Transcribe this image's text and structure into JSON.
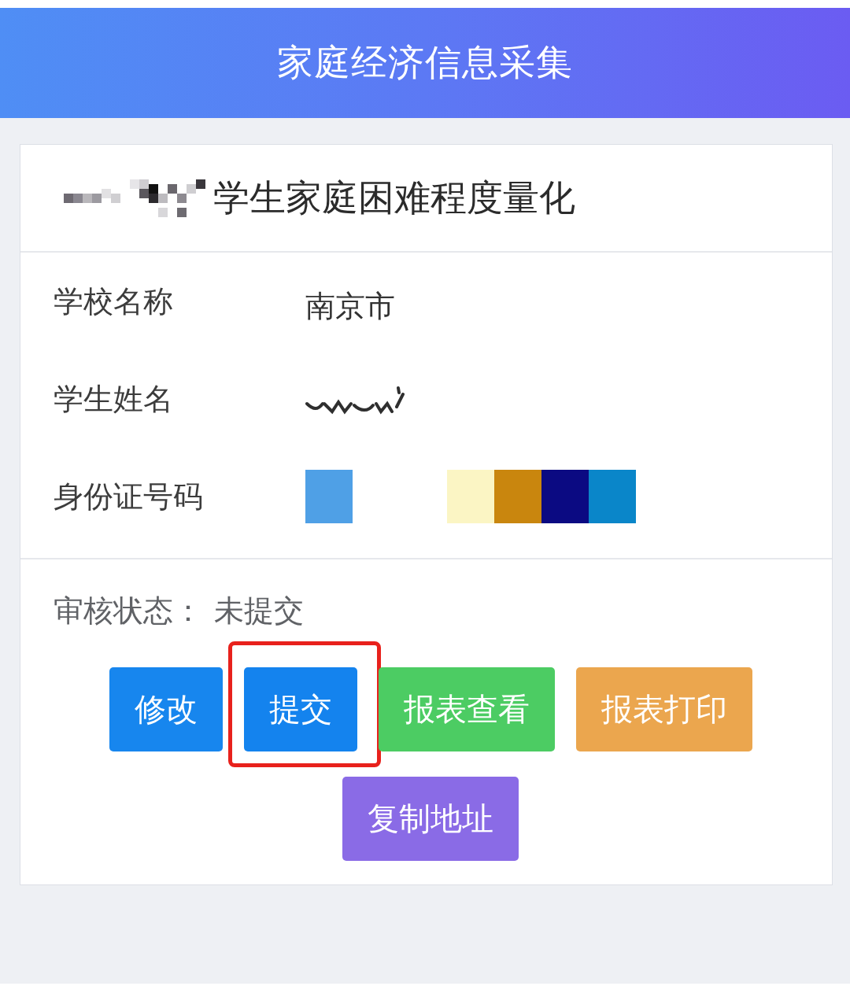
{
  "header": {
    "title": "家庭经济信息采集"
  },
  "card": {
    "title": {
      "text": "学生家庭困难程度量化",
      "redacted_prefix": true
    },
    "fields": [
      {
        "kind": "text",
        "label": "学校名称",
        "value": "南京市"
      },
      {
        "kind": "redacted",
        "label": "学生姓名"
      },
      {
        "kind": "blocks",
        "label": "身份证号码",
        "block_groups": [
          {
            "blocks": [
              {
                "color": "#4fa0e6"
              }
            ]
          },
          {
            "blocks": [
              {
                "color": "#fbf5c4"
              },
              {
                "color": "#c9860e"
              },
              {
                "color": "#0b0a82"
              },
              {
                "color": "#0a86c9"
              }
            ]
          }
        ]
      }
    ],
    "status": {
      "label": "审核状态：",
      "value": "未提交"
    },
    "actions": [
      {
        "label": "修改",
        "color": "#1786ee",
        "highlighted": false
      },
      {
        "label": "提交",
        "color": "#1483ee",
        "highlighted": true
      },
      {
        "label": "报表查看",
        "color": "#4ccc63",
        "highlighted": false
      },
      {
        "label": "报表打印",
        "color": "#eba64e",
        "highlighted": false
      },
      {
        "label": "复制地址",
        "color": "#8a6be6",
        "highlighted": false
      }
    ]
  }
}
